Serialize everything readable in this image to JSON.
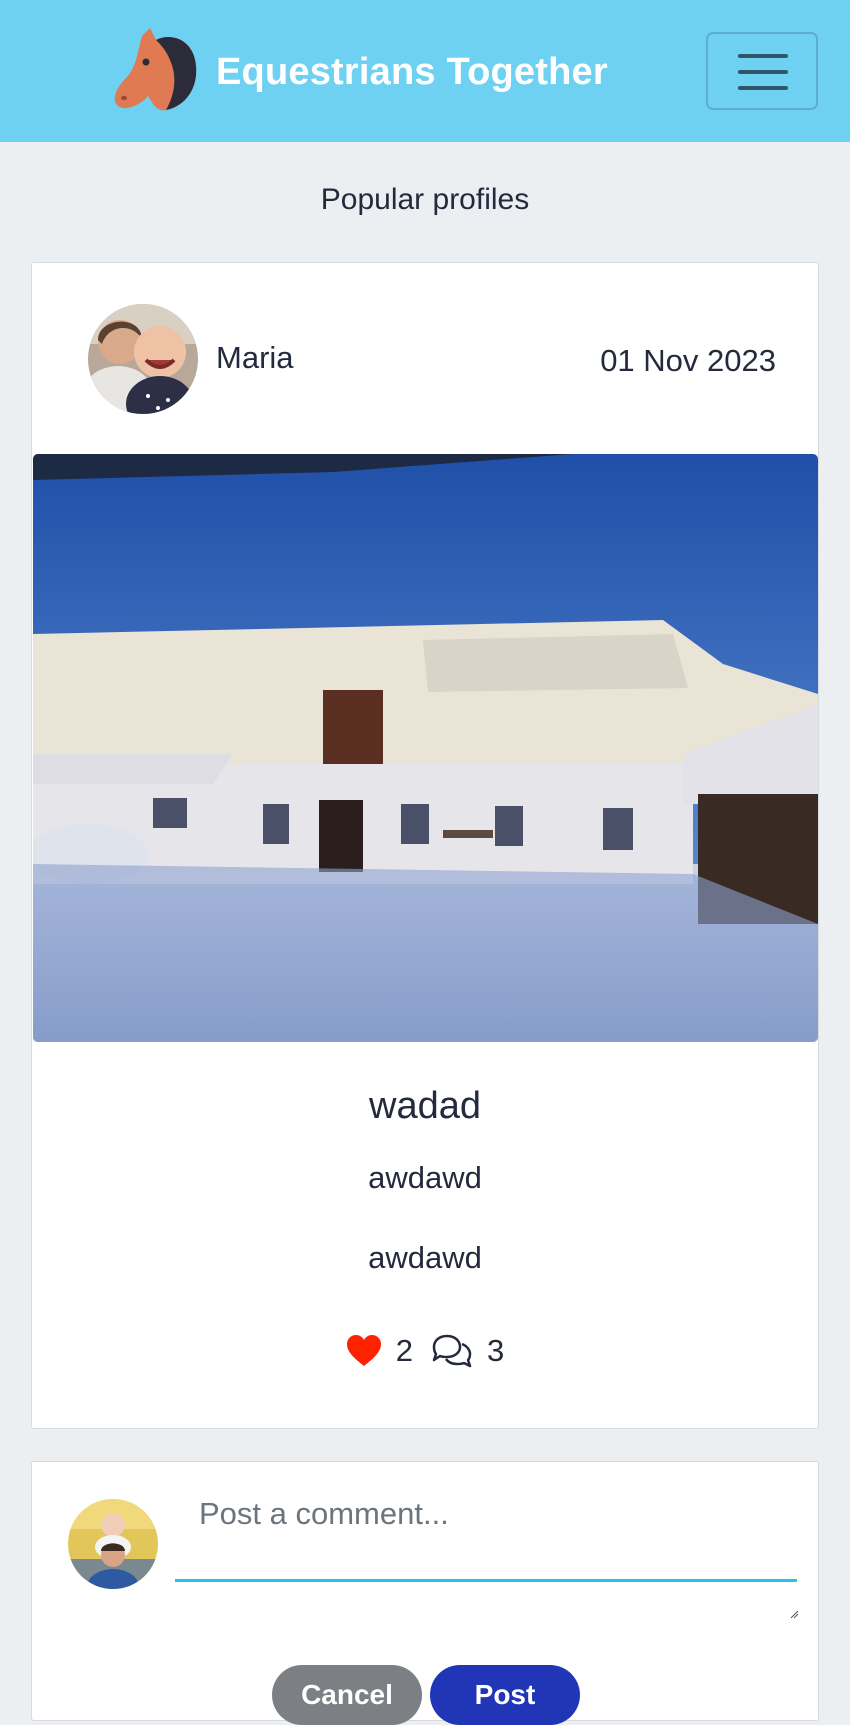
{
  "navbar": {
    "brand_title": "Equestrians Together",
    "logo_icon": "horse-head-icon",
    "menu_icon": "hamburger-menu-icon",
    "background_color": "#6ed1f2"
  },
  "popular_profiles": {
    "heading": "Popular profiles"
  },
  "post": {
    "author": "Maria",
    "date": "01 Nov 2023",
    "title": "wadad",
    "content": "awdawd",
    "content_repeat": "awdawd",
    "likes_count": "2",
    "comments_count": "3",
    "like_icon": "heart-icon",
    "comment_icon": "chat-bubbles-icon",
    "like_color": "#ff2200"
  },
  "comment_form": {
    "placeholder": "Post a comment...",
    "cancel_label": "Cancel",
    "post_label": "Post",
    "accent_color": "#22c4ea",
    "post_button_color": "#2136b6",
    "cancel_button_color": "#7c7f83"
  }
}
